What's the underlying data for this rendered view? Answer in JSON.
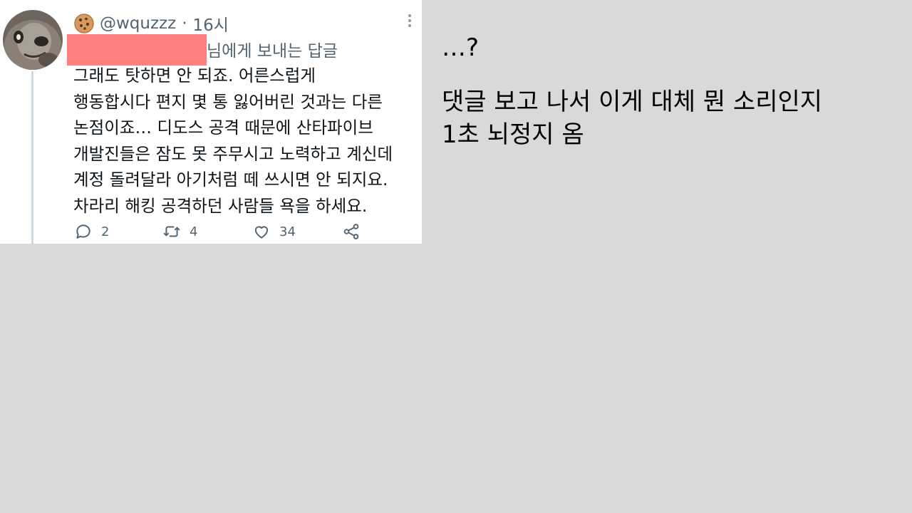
{
  "tweet": {
    "handle": "@wquzzz",
    "separator": "·",
    "time": "16시",
    "reply_to_suffix": "님에게 보내는 답글",
    "body_lines": [
      "그래도 탓하면 안 되죠. 어른스럽게",
      "행동합시다 편지 몇 통 잃어버린 것과는 다른",
      "논점이죠… 디도스 공격 때문에 산타파이브",
      "개발진들은 잠도 못 주무시고 노력하고 계신데",
      "계정 돌려달라 아기처럼 떼 쓰시면 안 되지요.",
      "차라리 해킹 공격하던 사람들 욕을 하세요."
    ],
    "actions": {
      "reply_count": "2",
      "retweet_count": "4",
      "like_count": "34"
    },
    "icons": [
      "cookie-icon",
      "more-icon",
      "reply-icon",
      "retweet-icon",
      "like-icon",
      "share-icon"
    ],
    "colors": {
      "redaction": "#ff7f7f",
      "secondary_text": "#536471",
      "body_text": "#0f1419"
    }
  },
  "comment": {
    "line1": "…?",
    "line2": "댓글 보고 나서 이게 대체 뭔 소리인지",
    "line3": "1초 뇌정지 옴"
  },
  "background_color": "#d9d9d9"
}
